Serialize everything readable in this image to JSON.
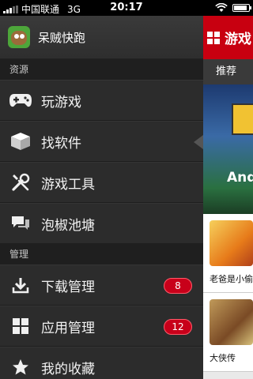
{
  "status_bar": {
    "carrier": "中国联通",
    "network": "3G",
    "time": "20:17",
    "battery_level": 0.9
  },
  "app": {
    "title": "呆贼快跑",
    "logo_icon": "game-character-logo",
    "accent_color": "#c80010"
  },
  "drawer": {
    "sections": [
      {
        "title": "资源",
        "items": [
          {
            "label": "玩游戏",
            "icon": "gamepad-icon"
          },
          {
            "label": "找软件",
            "icon": "box-icon",
            "selected": true
          },
          {
            "label": "游戏工具",
            "icon": "tools-icon"
          },
          {
            "label": "泡椒池塘",
            "icon": "chat-bubbles-icon"
          }
        ]
      },
      {
        "title": "管理",
        "items": [
          {
            "label": "下载管理",
            "icon": "download-icon",
            "badge": "8"
          },
          {
            "label": "应用管理",
            "icon": "apps-grid-icon",
            "badge": "12"
          },
          {
            "label": "我的收藏",
            "icon": "star-icon"
          }
        ]
      }
    ]
  },
  "content_peek": {
    "title": "游戏",
    "tab": "推荐",
    "banner_text": "And",
    "list": [
      {
        "title": "老爸是小偷"
      },
      {
        "title": "大侠传"
      }
    ]
  }
}
